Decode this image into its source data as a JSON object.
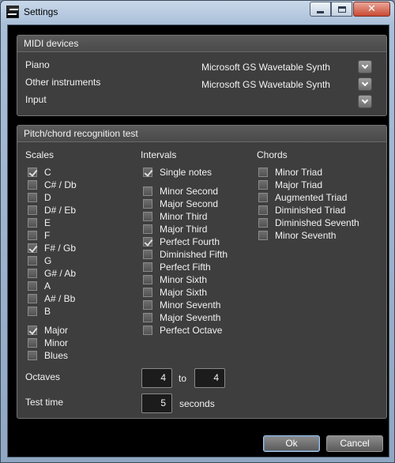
{
  "window": {
    "title": "Settings",
    "minimize": "",
    "maximize": "",
    "close": "✕"
  },
  "midi": {
    "header": "MIDI devices",
    "rows": [
      {
        "label": "Piano",
        "value": "Microsoft GS Wavetable Synth"
      },
      {
        "label": "Other instruments",
        "value": "Microsoft GS Wavetable Synth"
      },
      {
        "label": "Input",
        "value": ""
      }
    ]
  },
  "test": {
    "header": "Pitch/chord recognition test",
    "scales": {
      "heading": "Scales",
      "notes": [
        {
          "label": "C",
          "checked": true
        },
        {
          "label": "C# / Db",
          "checked": false
        },
        {
          "label": "D",
          "checked": false
        },
        {
          "label": "D# / Eb",
          "checked": false
        },
        {
          "label": "E",
          "checked": false
        },
        {
          "label": "F",
          "checked": false
        },
        {
          "label": "F# / Gb",
          "checked": true
        },
        {
          "label": "G",
          "checked": false
        },
        {
          "label": "G# / Ab",
          "checked": false
        },
        {
          "label": "A",
          "checked": false
        },
        {
          "label": "A# / Bb",
          "checked": false
        },
        {
          "label": "B",
          "checked": false
        }
      ],
      "modes": [
        {
          "label": "Major",
          "checked": true
        },
        {
          "label": "Minor",
          "checked": false
        },
        {
          "label": "Blues",
          "checked": false
        }
      ]
    },
    "intervals": {
      "heading": "Intervals",
      "single_notes": {
        "label": "Single notes",
        "checked": true
      },
      "items": [
        {
          "label": "Minor Second",
          "checked": false
        },
        {
          "label": "Major Second",
          "checked": false
        },
        {
          "label": "Minor Third",
          "checked": false
        },
        {
          "label": "Major Third",
          "checked": false
        },
        {
          "label": "Perfect Fourth",
          "checked": true
        },
        {
          "label": "Diminished Fifth",
          "checked": false
        },
        {
          "label": "Perfect Fifth",
          "checked": false
        },
        {
          "label": "Minor Sixth",
          "checked": false
        },
        {
          "label": "Major Sixth",
          "checked": false
        },
        {
          "label": "Minor Seventh",
          "checked": false
        },
        {
          "label": "Major Seventh",
          "checked": false
        },
        {
          "label": "Perfect Octave",
          "checked": false
        }
      ]
    },
    "chords": {
      "heading": "Chords",
      "items": [
        {
          "label": "Minor Triad",
          "checked": false
        },
        {
          "label": "Major Triad",
          "checked": false
        },
        {
          "label": "Augmented Triad",
          "checked": false
        },
        {
          "label": "Diminished Triad",
          "checked": false
        },
        {
          "label": "Diminished Seventh",
          "checked": false
        },
        {
          "label": "Minor Seventh",
          "checked": false
        }
      ]
    },
    "octaves": {
      "label": "Octaves",
      "from": "4",
      "to_label": "to",
      "to": "4"
    },
    "test_time": {
      "label": "Test time",
      "value": "5",
      "unit": "seconds"
    }
  },
  "buttons": {
    "ok": "Ok",
    "cancel": "Cancel"
  }
}
